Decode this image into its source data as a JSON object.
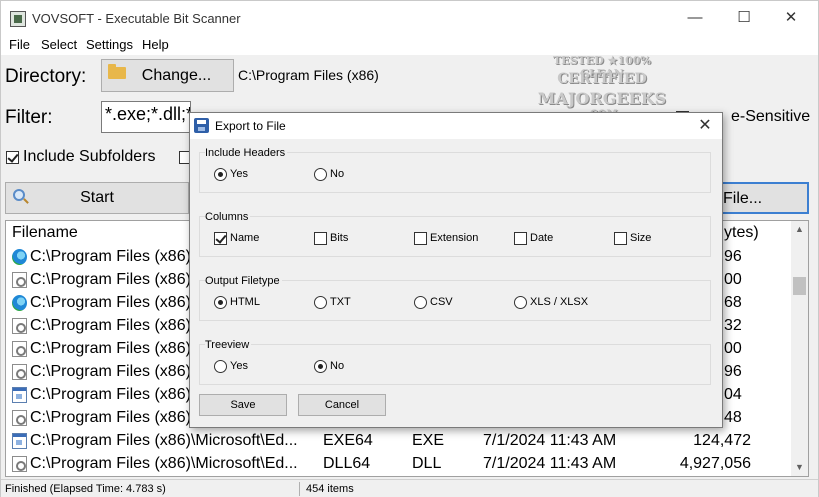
{
  "window": {
    "title": "VOVSOFT - Executable Bit Scanner",
    "min_glyph": "—",
    "max_glyph": "☐",
    "close_glyph": "✕"
  },
  "menu": [
    "File",
    "Select",
    "Settings",
    "Help"
  ],
  "directory": {
    "label": "Directory:",
    "button_label": "Change...",
    "path": "C:\\Program Files (x86)"
  },
  "filter": {
    "label": "Filter:",
    "value": "*.exe;*.dll;*",
    "case_sensitive_label": "e-Sensitive",
    "case_sensitive_checked": false
  },
  "include_subfolders": {
    "label": "Include Subfolders",
    "checked": true
  },
  "start_button_label": "Start",
  "save_button_label_visible": "File...",
  "list": {
    "columns": [
      "Filename",
      "ytes)"
    ],
    "rows": [
      {
        "icon": "edge-icon",
        "filename": "C:\\Program Files (x86)",
        "size": "96"
      },
      {
        "icon": "dll-icon",
        "filename": "C:\\Program Files (x86)",
        "size": "00"
      },
      {
        "icon": "edge-icon",
        "filename": "C:\\Program Files (x86)",
        "size": "68"
      },
      {
        "icon": "dll-icon",
        "filename": "C:\\Program Files (x86)",
        "size": "32"
      },
      {
        "icon": "dll-icon",
        "filename": "C:\\Program Files (x86)",
        "size": "00"
      },
      {
        "icon": "dll-icon",
        "filename": "C:\\Program Files (x86)",
        "size": "96"
      },
      {
        "icon": "exe-icon",
        "filename": "C:\\Program Files (x86)",
        "size": "04"
      },
      {
        "icon": "dll-icon",
        "filename": "C:\\Program Files (x86)",
        "size": "48"
      },
      {
        "icon": "exe-icon",
        "filename": "C:\\Program Files (x86)\\Microsoft\\Ed...",
        "bits": "EXE64",
        "ext": "EXE",
        "date": "7/1/2024 11:43 AM",
        "size": "124,472"
      },
      {
        "icon": "dll-icon",
        "filename": "C:\\Program Files (x86)\\Microsoft\\Ed...",
        "bits": "DLL64",
        "ext": "DLL",
        "date": "7/1/2024 11:43 AM",
        "size": "4,927,056"
      }
    ]
  },
  "status": {
    "left": "Finished (Elapsed Time: 4.783 s)",
    "right": "454 items"
  },
  "watermark": {
    "line1": "TESTED ★100% CLEAN",
    "line2": "CERTIFIED",
    "line3": "MAJORGEEKS",
    "line4": ".COM"
  },
  "dialog": {
    "title": "Export to File",
    "close_glyph": "✕",
    "include_headers": {
      "label": "Include Headers",
      "options": [
        "Yes",
        "No"
      ],
      "selected": "Yes"
    },
    "columns": {
      "label": "Columns",
      "options": [
        {
          "label": "Name",
          "checked": true
        },
        {
          "label": "Bits",
          "checked": false
        },
        {
          "label": "Extension",
          "checked": false
        },
        {
          "label": "Date",
          "checked": false
        },
        {
          "label": "Size",
          "checked": false
        }
      ]
    },
    "output_filetype": {
      "label": "Output Filetype",
      "options": [
        "HTML",
        "TXT",
        "CSV",
        "XLS / XLSX"
      ],
      "selected": "HTML"
    },
    "treeview": {
      "label": "Treeview",
      "options": [
        "Yes",
        "No"
      ],
      "selected": "No"
    },
    "save_label": "Save",
    "cancel_label": "Cancel"
  }
}
